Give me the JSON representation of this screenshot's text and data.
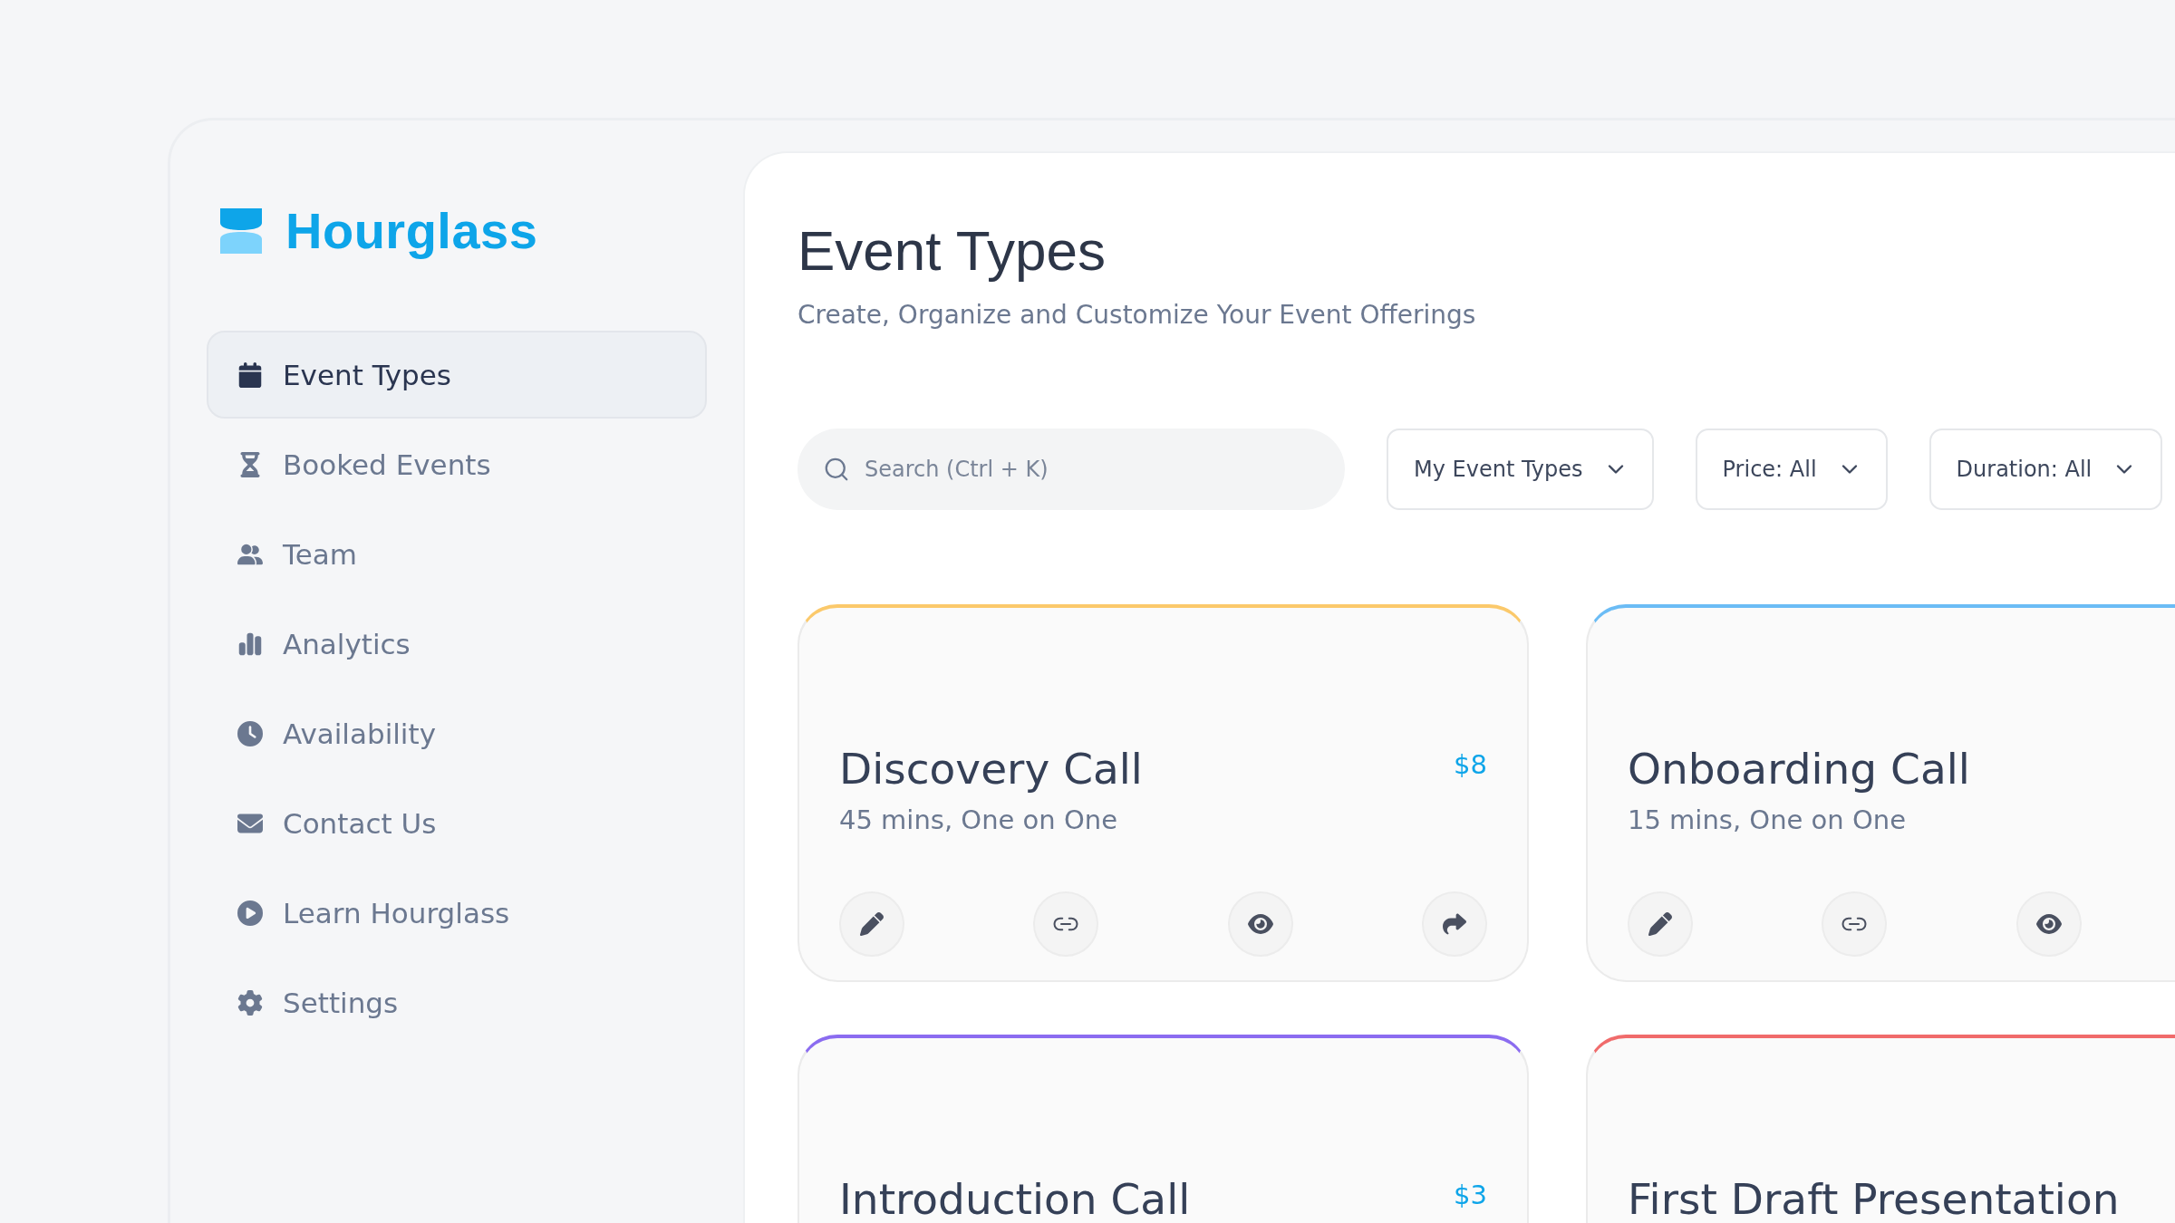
{
  "brand": {
    "name": "Hourglass"
  },
  "sidebar": {
    "items": [
      {
        "label": "Event Types",
        "selected": true
      },
      {
        "label": "Booked Events",
        "selected": false
      },
      {
        "label": "Team",
        "selected": false
      },
      {
        "label": "Analytics",
        "selected": false
      },
      {
        "label": "Availability",
        "selected": false
      },
      {
        "label": "Contact Us",
        "selected": false
      },
      {
        "label": "Learn Hourglass",
        "selected": false
      },
      {
        "label": "Settings",
        "selected": false
      }
    ]
  },
  "header": {
    "title": "Event Types",
    "subtitle": "Create, Organize and Customize Your Event Offerings"
  },
  "search": {
    "placeholder": "Search (Ctrl + K)"
  },
  "filters": [
    {
      "label": "My Event Types"
    },
    {
      "label": "Price: All"
    },
    {
      "label": "Duration: All"
    }
  ],
  "cards": [
    {
      "title": "Discovery Call",
      "details": "45 mins, One on One",
      "price": "$8",
      "color": "#fbc96b"
    },
    {
      "title": "Onboarding Call",
      "details": "15 mins, One on One",
      "color": "#6bbcf5"
    },
    {
      "title": "Introduction Call",
      "price": "$3",
      "color": "#8b6cf0"
    },
    {
      "title": "First Draft Presentation",
      "color": "#f06b6b"
    }
  ]
}
